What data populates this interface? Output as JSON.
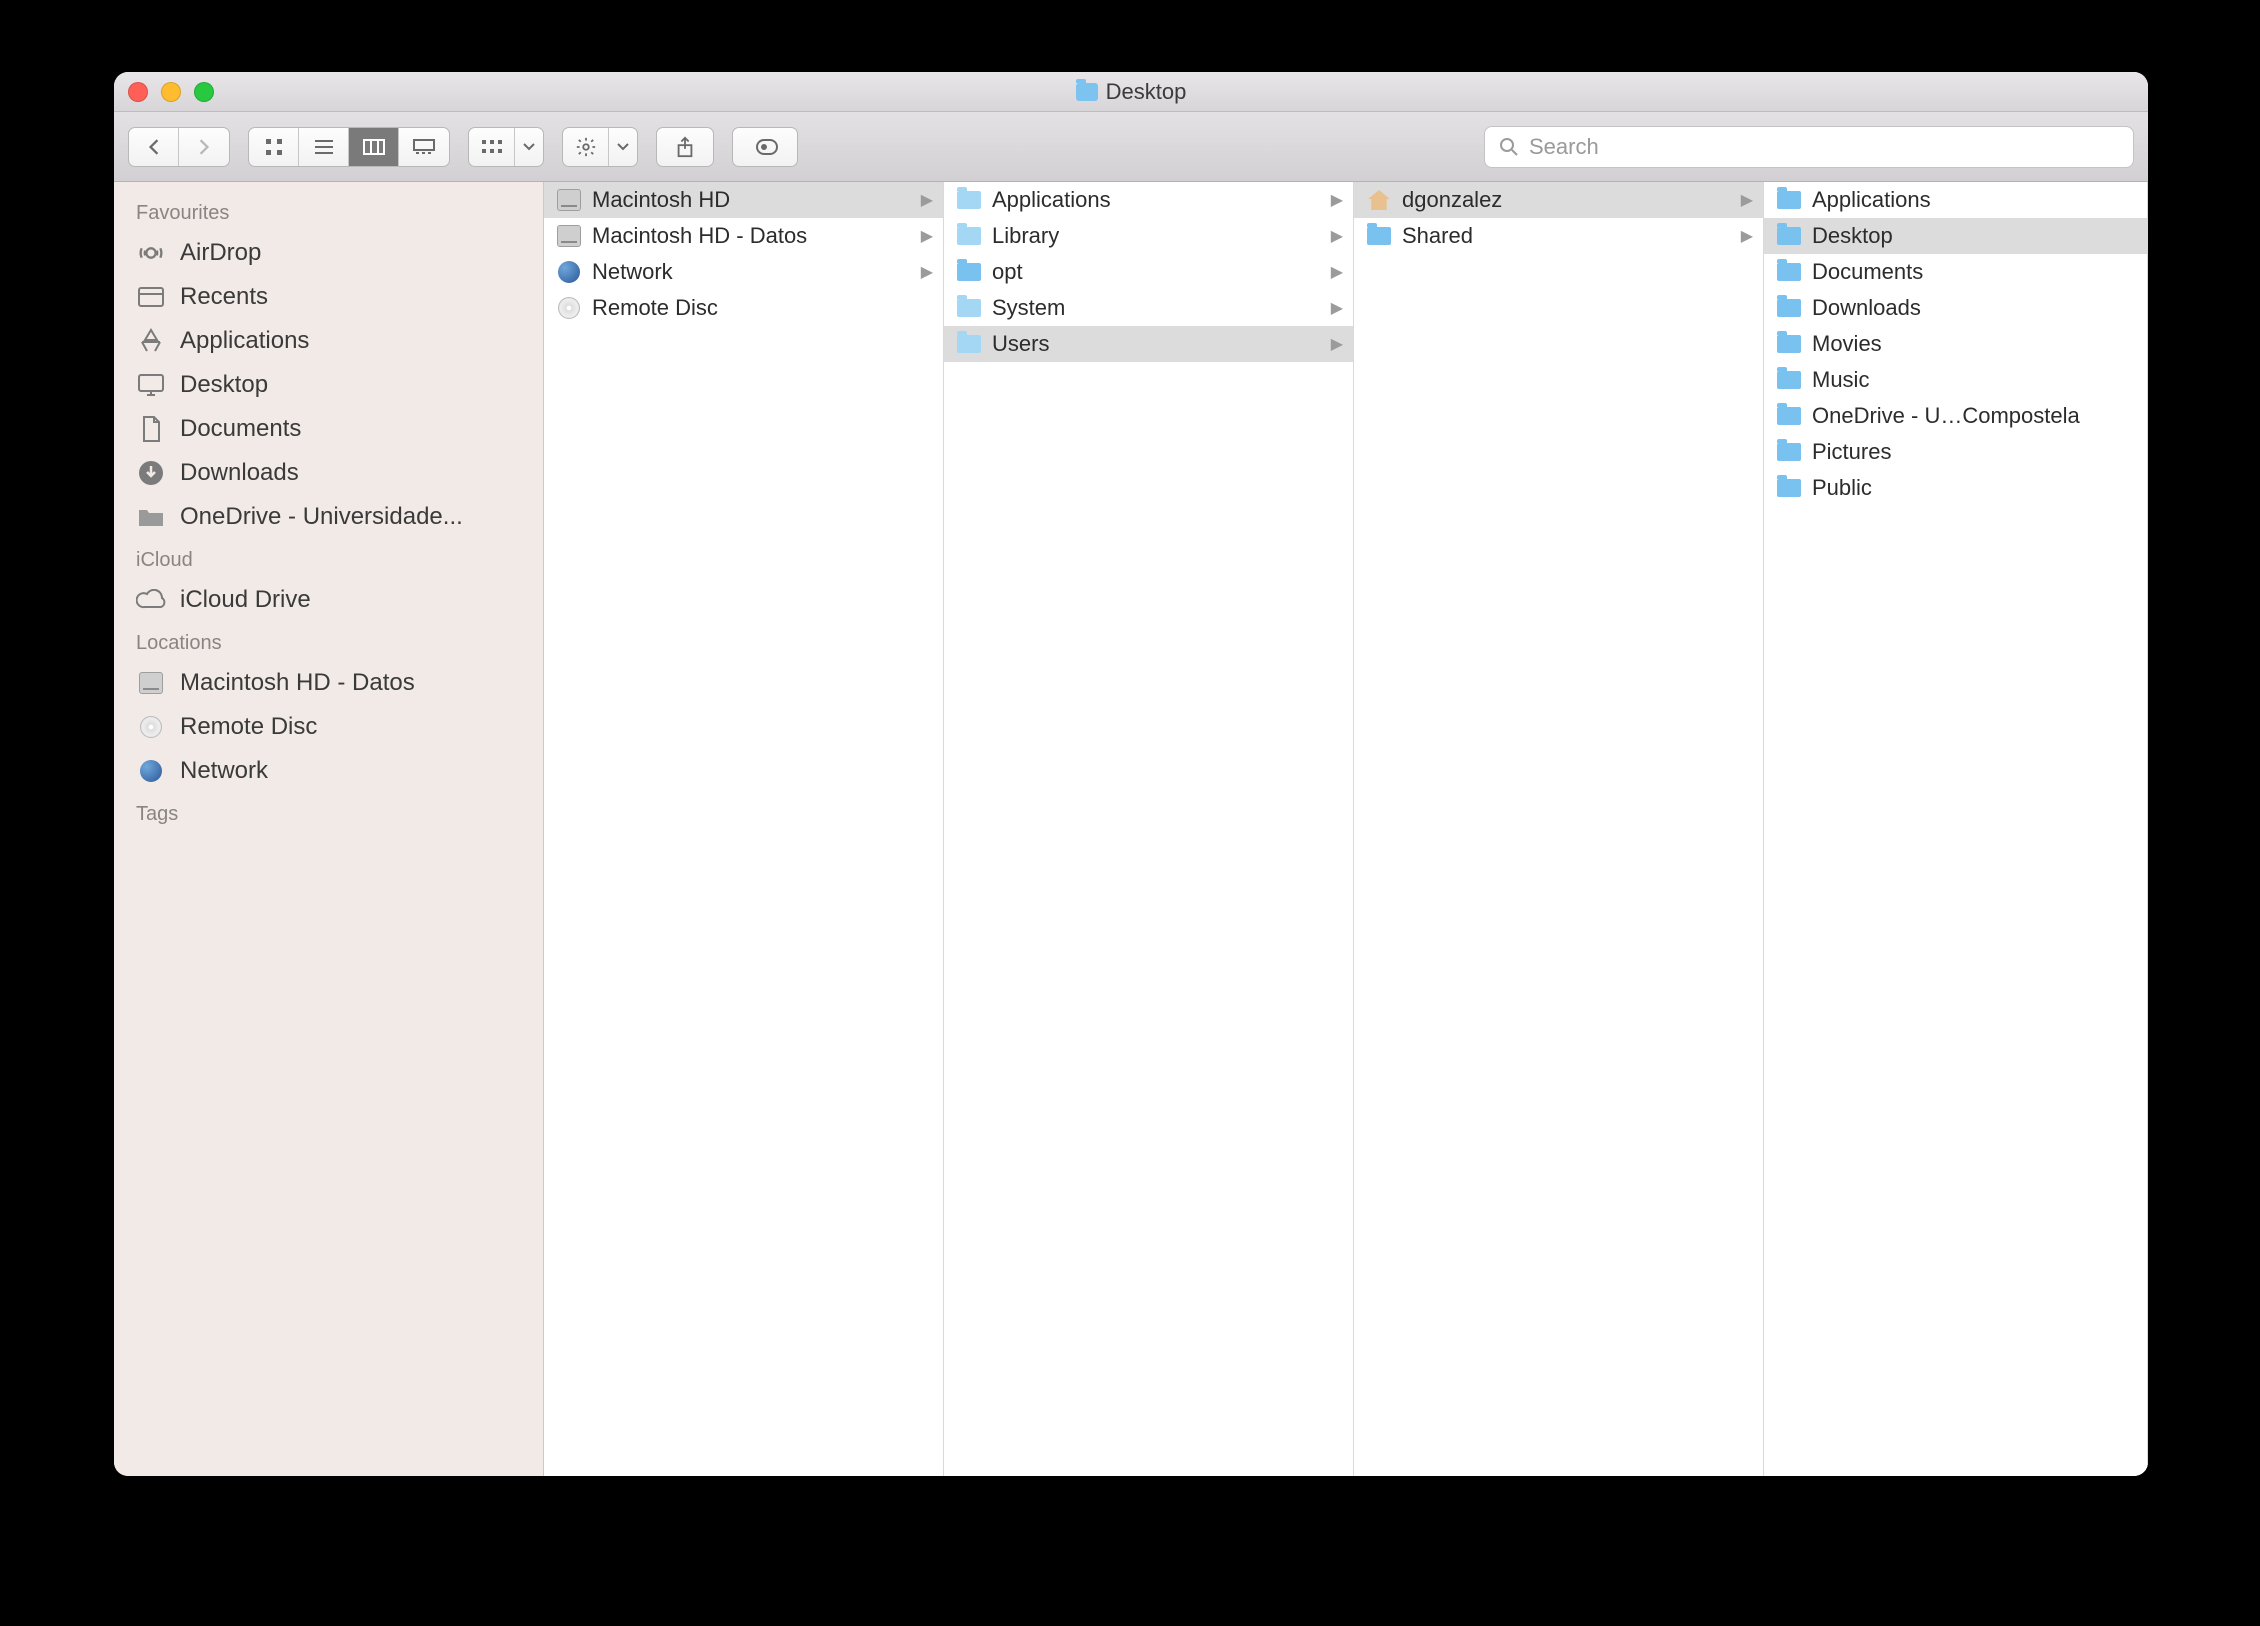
{
  "window": {
    "title": "Desktop"
  },
  "search": {
    "placeholder": "Search"
  },
  "sidebar": {
    "sections": [
      {
        "title": "Favourites",
        "items": [
          {
            "label": "AirDrop",
            "icon": "airdrop"
          },
          {
            "label": "Recents",
            "icon": "recents"
          },
          {
            "label": "Applications",
            "icon": "applications"
          },
          {
            "label": "Desktop",
            "icon": "desktop"
          },
          {
            "label": "Documents",
            "icon": "documents"
          },
          {
            "label": "Downloads",
            "icon": "downloads"
          },
          {
            "label": "OneDrive - Universidade...",
            "icon": "folder-grey"
          }
        ]
      },
      {
        "title": "iCloud",
        "items": [
          {
            "label": "iCloud Drive",
            "icon": "cloud"
          }
        ]
      },
      {
        "title": "Locations",
        "items": [
          {
            "label": "Macintosh HD - Datos",
            "icon": "hd"
          },
          {
            "label": "Remote Disc",
            "icon": "disc"
          },
          {
            "label": "Network",
            "icon": "globe"
          }
        ]
      },
      {
        "title": "Tags",
        "items": []
      }
    ]
  },
  "columns": [
    {
      "items": [
        {
          "label": "Macintosh HD",
          "icon": "hd",
          "arrow": true,
          "selected": true
        },
        {
          "label": "Macintosh HD - Datos",
          "icon": "hd",
          "arrow": true
        },
        {
          "label": "Network",
          "icon": "globe",
          "arrow": true
        },
        {
          "label": "Remote Disc",
          "icon": "disc",
          "arrow": false
        }
      ]
    },
    {
      "items": [
        {
          "label": "Applications",
          "icon": "folder-sys",
          "arrow": true
        },
        {
          "label": "Library",
          "icon": "folder-sys",
          "arrow": true
        },
        {
          "label": "opt",
          "icon": "folder",
          "arrow": true
        },
        {
          "label": "System",
          "icon": "folder-sys",
          "arrow": true
        },
        {
          "label": "Users",
          "icon": "folder-sys",
          "arrow": true,
          "selected": true
        }
      ]
    },
    {
      "items": [
        {
          "label": "dgonzalez",
          "icon": "home",
          "arrow": true,
          "selected": true
        },
        {
          "label": "Shared",
          "icon": "folder",
          "arrow": true
        }
      ]
    },
    {
      "items": [
        {
          "label": "Applications",
          "icon": "folder",
          "arrow": false
        },
        {
          "label": "Desktop",
          "icon": "folder",
          "arrow": false,
          "selected": true
        },
        {
          "label": "Documents",
          "icon": "folder",
          "arrow": false
        },
        {
          "label": "Downloads",
          "icon": "folder",
          "arrow": false
        },
        {
          "label": "Movies",
          "icon": "folder",
          "arrow": false
        },
        {
          "label": "Music",
          "icon": "folder",
          "arrow": false
        },
        {
          "label": "OneDrive - U…Compostela",
          "icon": "folder",
          "arrow": false
        },
        {
          "label": "Pictures",
          "icon": "folder",
          "arrow": false
        },
        {
          "label": "Public",
          "icon": "folder",
          "arrow": false
        }
      ]
    }
  ]
}
